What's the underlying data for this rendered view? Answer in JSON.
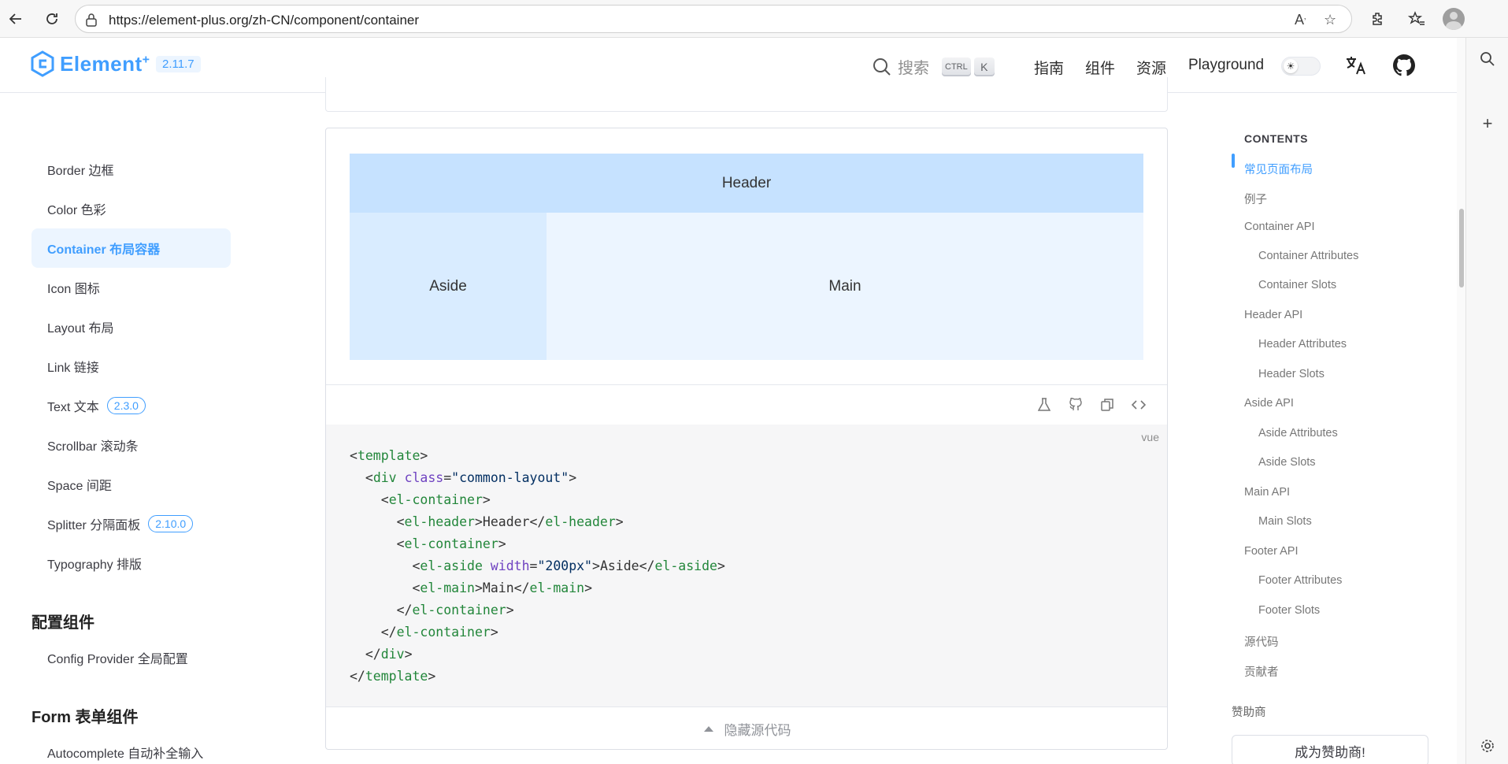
{
  "browser": {
    "url": "https://element-plus.org/zh-CN/component/container"
  },
  "header": {
    "logo_text": "Element",
    "logo_sup": "+",
    "version": "2.11.7",
    "search_placeholder": "搜索",
    "kbd_ctrl": "CTRL",
    "kbd_k": "K",
    "nav": [
      "指南",
      "组件",
      "资源",
      "Playground"
    ]
  },
  "sidebar": {
    "items": [
      {
        "label": "Border 边框"
      },
      {
        "label": "Color 色彩"
      },
      {
        "label": "Container 布局容器"
      },
      {
        "label": "Icon 图标"
      },
      {
        "label": "Layout 布局"
      },
      {
        "label": "Link 链接"
      },
      {
        "label": "Text 文本",
        "tag": "2.3.0"
      },
      {
        "label": "Scrollbar 滚动条"
      },
      {
        "label": "Space 间距"
      },
      {
        "label": "Splitter 分隔面板",
        "tag": "2.10.0"
      },
      {
        "label": "Typography 排版"
      }
    ],
    "group_config": "配置组件",
    "config_items": [
      {
        "label": "Config Provider 全局配置"
      }
    ],
    "group_form": "Form 表单组件",
    "form_items": [
      {
        "label": "Autocomplete 自动补全输入"
      }
    ]
  },
  "demo": {
    "header": "Header",
    "aside": "Aside",
    "main": "Main",
    "code_lang": "vue",
    "hide_code": "隐藏源代码"
  },
  "toc": {
    "title": "CONTENTS",
    "items": [
      {
        "label": "常见页面布局"
      },
      {
        "label": "例子"
      },
      {
        "label": "Container API"
      },
      {
        "label": "Container Attributes"
      },
      {
        "label": "Container Slots"
      },
      {
        "label": "Header API"
      },
      {
        "label": "Header Attributes"
      },
      {
        "label": "Header Slots"
      },
      {
        "label": "Aside API"
      },
      {
        "label": "Aside Attributes"
      },
      {
        "label": "Aside Slots"
      },
      {
        "label": "Main API"
      },
      {
        "label": "Main Slots"
      },
      {
        "label": "Footer API"
      },
      {
        "label": "Footer Attributes"
      },
      {
        "label": "Footer Slots"
      },
      {
        "label": "源代码"
      },
      {
        "label": "贡献者"
      }
    ],
    "sponsor_title": "赞助商",
    "sponsor_button": "成为赞助商!"
  },
  "colors": {
    "brand": "#409eff",
    "header_bg": "#c6e2ff",
    "aside_bg": "#d9ecff",
    "main_bg": "#ecf5ff"
  }
}
